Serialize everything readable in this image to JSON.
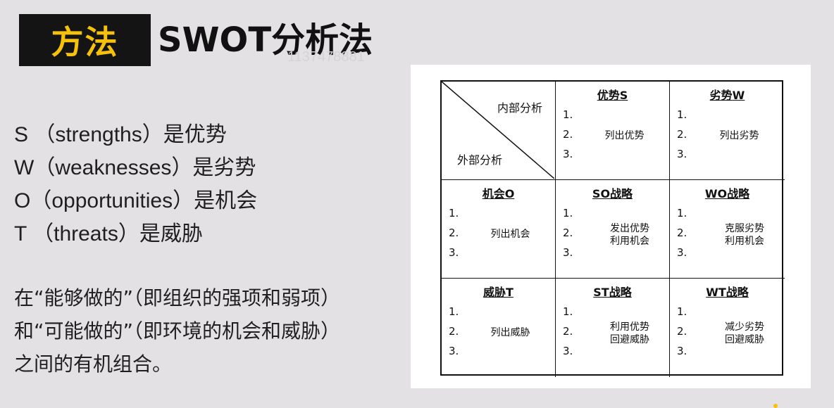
{
  "title": {
    "badge": "方法",
    "main": "SWOT分析法"
  },
  "watermark": "1137478881",
  "swot_list": [
    "S （strengths）是优势",
    "W（weaknesses）是劣势",
    "O（opportunities）是机会",
    "T （threats）是威胁"
  ],
  "summary": [
    "在“能够做的”（即组织的强项和弱项）",
    "和“可能做的”（即环境的机会和威胁）",
    "之间的有机组合。"
  ],
  "matrix": {
    "corner": {
      "inner": "内部分析",
      "outer": "外部分析"
    },
    "numbers": [
      "1.",
      "2.",
      "3."
    ],
    "strengths": {
      "head": "优势S",
      "body": [
        "列出优势"
      ]
    },
    "weaknesses": {
      "head": "劣势W",
      "body": [
        "列出劣势"
      ]
    },
    "opportunities": {
      "head": "机会O",
      "body": [
        "列出机会"
      ]
    },
    "so": {
      "head": "SO战略",
      "body": [
        "发出优势",
        "利用机会"
      ]
    },
    "wo": {
      "head": "WO战略",
      "body": [
        "克服劣势",
        "利用机会"
      ]
    },
    "threats": {
      "head": "威胁T",
      "body": [
        "列出威胁"
      ]
    },
    "st": {
      "head": "ST战略",
      "body": [
        "利用优势",
        "回避威胁"
      ]
    },
    "wt": {
      "head": "WT战略",
      "body": [
        "减少劣势",
        "回避威胁"
      ]
    }
  },
  "colors": {
    "background": "#e4e1e5",
    "badge_bg": "#141414",
    "badge_text": "#f5c10a"
  }
}
